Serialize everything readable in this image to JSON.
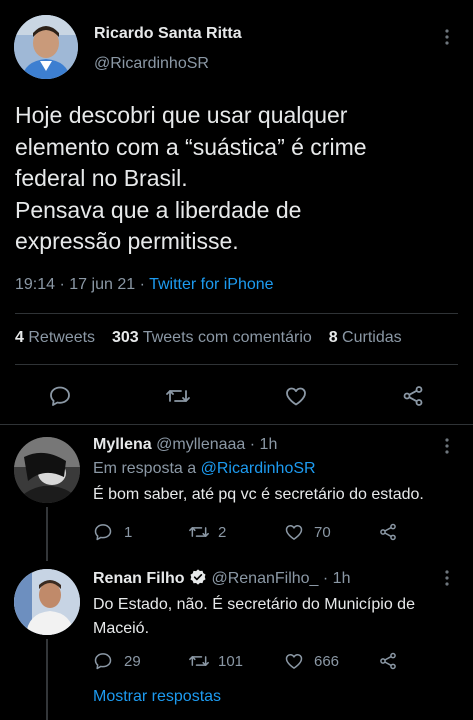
{
  "tweet": {
    "author_name": "Ricardo Santa Ritta",
    "handle": "@RicardinhoSR",
    "text_lines": [
      "Hoje descobri que usar qualquer",
      "elemento com a “suástica” é crime",
      "federal no Brasil.",
      "Pensava que a liberdade de",
      "expressão permitisse."
    ],
    "time": "19:14",
    "sep1": "·",
    "date": "17 jun 21",
    "sep2": "·",
    "source": "Twitter for iPhone",
    "retweets_count": "4",
    "retweets_label": "Retweets",
    "quotes_count": "303",
    "quotes_label": "Tweets com comentário",
    "likes_count": "8",
    "likes_label": "Curtidas"
  },
  "replies": [
    {
      "name": "Myllena",
      "handle": "@myllenaaa",
      "dot": "·",
      "time": "1h",
      "reply_prefix": "Em resposta a",
      "reply_to": "@RicardinhoSR",
      "text": "É bom saber, até pq vc é secretário do estado.",
      "reply_count": "1",
      "retweet_count": "2",
      "like_count": "70"
    },
    {
      "name": "Renan Filho",
      "handle": "@RenanFilho_",
      "dot": "·",
      "time": "1h",
      "text_lines": [
        "Do Estado, não. É secretário do Município de",
        "Maceió."
      ],
      "reply_count": "29",
      "retweet_count": "101",
      "like_count": "666"
    }
  ],
  "show_replies": "Mostrar respostas",
  "colors": {
    "background": "#000000",
    "text": "#e7e9ea",
    "muted": "#8b98a5",
    "link": "#1d9bf0",
    "verified": "#e7e9ea"
  },
  "icons": [
    "more-icon",
    "reply-icon",
    "retweet-icon",
    "like-icon",
    "share-icon",
    "verified-icon"
  ]
}
